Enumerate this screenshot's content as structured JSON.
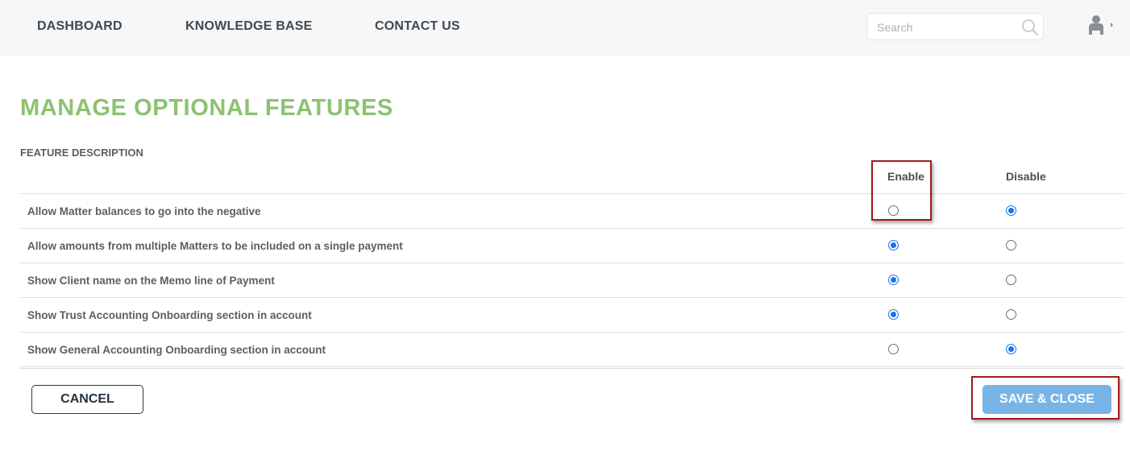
{
  "nav": {
    "items": [
      "DASHBOARD",
      "KNOWLEDGE BASE",
      "CONTACT US"
    ],
    "search_placeholder": "Search"
  },
  "page": {
    "title": "MANAGE OPTIONAL FEATURES",
    "section_label": "FEATURE DESCRIPTION",
    "col_enable": "Enable",
    "col_disable": "Disable"
  },
  "features": [
    {
      "label": "Allow Matter balances to go into the negative",
      "selected": "disable"
    },
    {
      "label": "Allow amounts from multiple Matters to be included on a single payment",
      "selected": "enable"
    },
    {
      "label": "Show Client name on the Memo line of Payment",
      "selected": "enable"
    },
    {
      "label": "Show Trust Accounting Onboarding section in account",
      "selected": "enable"
    },
    {
      "label": "Show General Accounting Onboarding section in account",
      "selected": "disable"
    }
  ],
  "actions": {
    "cancel": "CANCEL",
    "save": "SAVE & CLOSE"
  },
  "colors": {
    "title": "#8cc270",
    "radio_selected": "#1a73e8",
    "save_button": "#79b4e6",
    "highlight_box": "#a01b1b"
  },
  "icons": {
    "search": "search-icon",
    "user": "user-icon",
    "caret": "caret-right-icon"
  }
}
